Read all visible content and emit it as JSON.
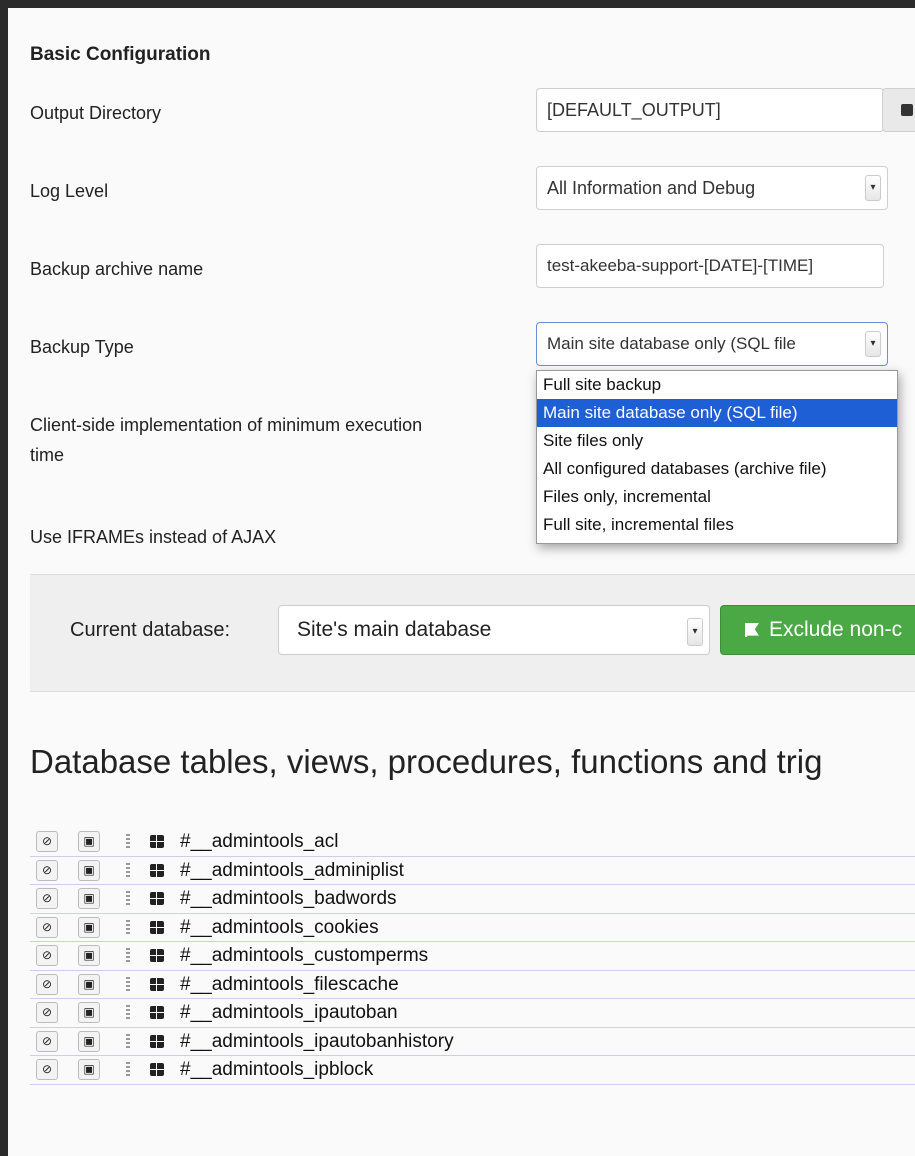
{
  "section": {
    "title": "Basic Configuration"
  },
  "fields": {
    "output_directory": {
      "label": "Output Directory",
      "value": "[DEFAULT_OUTPUT]"
    },
    "log_level": {
      "label": "Log Level",
      "value": "All Information and Debug"
    },
    "archive_name": {
      "label": "Backup archive name",
      "value": "test-akeeba-support-[DATE]-[TIME]"
    },
    "backup_type": {
      "label": "Backup Type",
      "value": "Main site database only (SQL file"
    },
    "min_exec": {
      "label_line1": "Client-side implementation of minimum execution",
      "label_line2": "time"
    },
    "iframes": {
      "label": "Use IFRAMEs instead of AJAX"
    }
  },
  "dropdown": {
    "options": [
      "Full site backup",
      "Main site database only (SQL file)",
      "Site files only",
      "All configured databases (archive file)",
      "Files only, incremental",
      "Full site, incremental files"
    ],
    "selected_index": 1
  },
  "database_bar": {
    "label": "Current database:",
    "selected": "Site's main database",
    "exclude_button": "Exclude non-c"
  },
  "tables_heading": "Database tables, views, procedures, functions and trig",
  "tables": [
    "#__admintools_acl",
    "#__admintools_adminiplist",
    "#__admintools_badwords",
    "#__admintools_cookies",
    "#__admintools_customperms",
    "#__admintools_filescache",
    "#__admintools_ipautoban",
    "#__admintools_ipautobanhistory",
    "#__admintools_ipblock"
  ],
  "icons": {
    "exclude": "exclude-icon",
    "filter": "filter-icon",
    "drag": "drag-handle-icon",
    "table": "table-icon",
    "folder": "folder-icon",
    "flag": "flag-icon"
  }
}
